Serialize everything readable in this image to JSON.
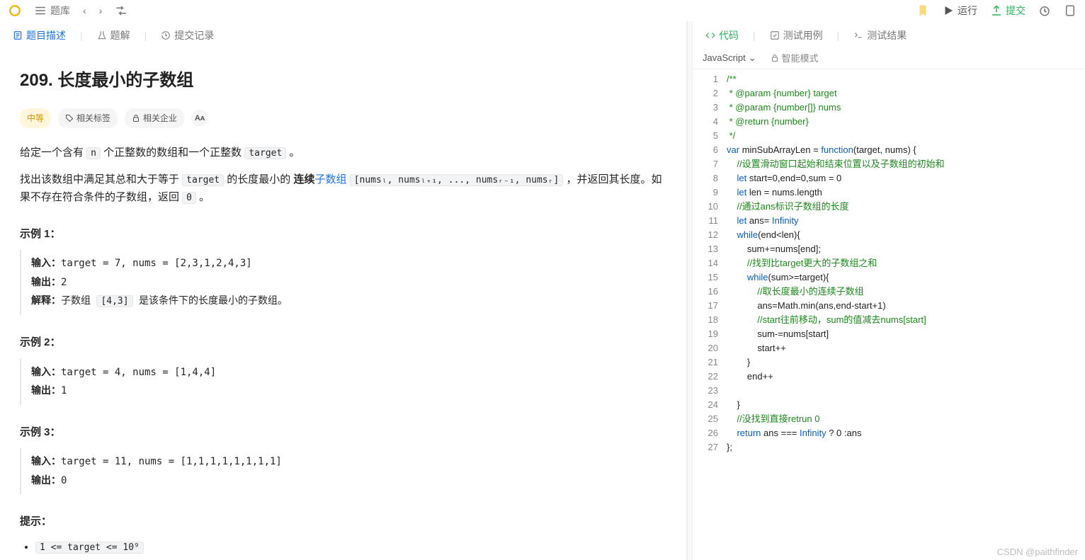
{
  "topbar": {
    "library": "题库",
    "run": "运行",
    "submit": "提交"
  },
  "leftTabs": {
    "desc": "题目描述",
    "solution": "题解",
    "records": "提交记录"
  },
  "problem": {
    "title": "209. 长度最小的子数组",
    "difficulty": "中等",
    "tagsLabel": "相关标签",
    "companyLabel": "相关企业",
    "p1_a": "给定一个含有 ",
    "p1_code1": "n",
    "p1_b": " 个正整数的数组和一个正整数 ",
    "p1_code2": "target",
    "p1_c": " 。",
    "p2_a": "找出该数组中满足其总和大于等于 ",
    "p2_code1": "target",
    "p2_b": " 的长度最小的 ",
    "p2_bold": "连续",
    "p2_link": "子数组",
    "p2_c": " ",
    "p2_code2": "[numsₗ, numsₗ₊₁, ..., numsᵣ₋₁, numsᵣ]",
    "p2_d": " ，并返回其长度。如果不存在符合条件的子数组，返回 ",
    "p2_code3": "0",
    "p2_e": " 。",
    "ex1_h": "示例 1：",
    "ex1_body": "<b>输入：</b>target = 7, nums = [2,3,1,2,4,3]\n<b>输出：</b>2\n<b>解释：</b>子数组 <code class=\"ic\">[4,3]</code> 是该条件下的长度最小的子数组。",
    "ex2_h": "示例 2：",
    "ex2_body": "<b>输入：</b>target = 4, nums = [1,4,4]\n<b>输出：</b>1",
    "ex3_h": "示例 3：",
    "ex3_body": "<b>输入：</b>target = 11, nums = [1,1,1,1,1,1,1,1]\n<b>输出：</b>0",
    "hint_h": "提示：",
    "hint1": "1 <= target <= 10⁹"
  },
  "rightTabs": {
    "code": "代码",
    "testcase": "测试用例",
    "result": "测试结果"
  },
  "editor": {
    "language": "JavaScript",
    "smartMode": "智能模式",
    "lines": [
      {
        "html": "<span class='c-doc'>/**</span>",
        "indent": 0
      },
      {
        "html": "<span class='c-doc'> * @param {number} target</span>",
        "indent": 0
      },
      {
        "html": "<span class='c-doc'> * @param {number[]} nums</span>",
        "indent": 0
      },
      {
        "html": "<span class='c-doc'> * @return {number}</span>",
        "indent": 0
      },
      {
        "html": "<span class='c-doc'> */</span>",
        "indent": 0
      },
      {
        "html": "<span class='c-kw'>var</span> <span class='c-txt'>minSubArrayLen = </span><span class='c-kw'>function</span><span class='c-txt'>(target, nums) {</span>",
        "indent": 0
      },
      {
        "html": "<span class='c-cmt'>//设置滑动窗口起始和结束位置以及子数组的初始和</span>",
        "indent": 1
      },
      {
        "html": "<span class='c-kw'>let</span> <span class='c-txt'>start=0,end=0,sum = 0</span>",
        "indent": 1
      },
      {
        "html": "<span class='c-kw'>let</span> <span class='c-txt'>len = nums.length</span>",
        "indent": 1
      },
      {
        "html": "<span class='c-cmt'>//通过ans标识子数组的长度</span>",
        "indent": 1
      },
      {
        "html": "<span class='c-kw'>let</span> <span class='c-txt'>ans= </span><span class='c-const'>Infinity</span>",
        "indent": 1
      },
      {
        "html": "<span class='c-kw'>while</span><span class='c-txt'>(end&lt;len){</span>",
        "indent": 1
      },
      {
        "html": "<span class='c-txt'>sum+=nums[end];</span>",
        "indent": 2
      },
      {
        "html": "<span class='c-cmt'>//找到比target更大的子数组之和</span>",
        "indent": 2
      },
      {
        "html": "<span class='c-kw'>while</span><span class='c-txt'>(sum&gt;=target){</span>",
        "indent": 2
      },
      {
        "html": "<span class='c-cmt'>//取长度最小的连续子数组</span>",
        "indent": 3
      },
      {
        "html": "<span class='c-txt'>ans=Math.min(ans,end-start+1)</span>",
        "indent": 3
      },
      {
        "html": "<span class='c-cmt'>//start往前移动，sum的值减去nums[start]</span>",
        "indent": 3
      },
      {
        "html": "<span class='c-txt'>sum-=nums[start]</span>",
        "indent": 3
      },
      {
        "html": "<span class='c-txt'>start++</span>",
        "indent": 3
      },
      {
        "html": "<span class='c-txt'>}</span>",
        "indent": 2
      },
      {
        "html": "<span class='c-txt'>end++</span>",
        "indent": 2
      },
      {
        "html": "",
        "indent": 0
      },
      {
        "html": "<span class='c-txt'>}</span>",
        "indent": 1
      },
      {
        "html": "<span class='c-cmt'>//没找到直接retrun 0</span>",
        "indent": 1
      },
      {
        "html": "<span class='c-kw'>return</span> <span class='c-txt'>ans === </span><span class='c-const'>Infinity</span><span class='c-txt'> ? 0 :ans</span>",
        "indent": 1
      },
      {
        "html": "<span class='c-txt'>};</span>",
        "indent": 0
      }
    ]
  },
  "watermark": "CSDN @paithfinder"
}
